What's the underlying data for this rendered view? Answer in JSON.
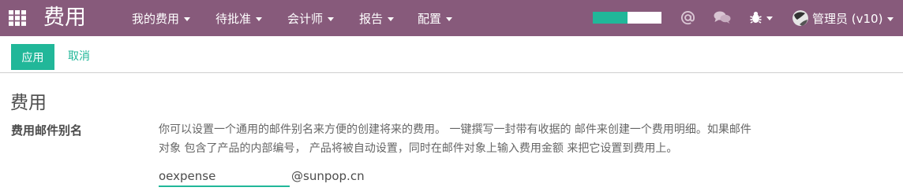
{
  "navbar": {
    "brand": "费用",
    "menus": [
      "我的费用",
      "待批准",
      "会计师",
      "报告",
      "配置"
    ],
    "progress": 0.5,
    "icons": [
      "apps-grid-icon",
      "at-icon",
      "chat-icon",
      "bug-icon"
    ],
    "user_name": "管理员 (v10)"
  },
  "control_panel": {
    "apply_label": "应用",
    "cancel_label": "取消"
  },
  "settings": {
    "section_title": "费用",
    "field_label": "费用邮件别名",
    "help_line1": "你可以设置一个通用的邮件别名来方便的创建将来的费用。 一键撰写一封带有收据的 邮件来创建一个费用明细。如果邮件",
    "help_line2": "对象 包含了产品的内部编号， 产品将被自动设置，同时在邮件对象上输入费用金额 来把它设置到费用上。",
    "alias_value": "oexpense",
    "alias_domain": "@sunpop.cn"
  },
  "colors": {
    "navbar_bg": "#875A7B",
    "accent": "#21B799"
  }
}
